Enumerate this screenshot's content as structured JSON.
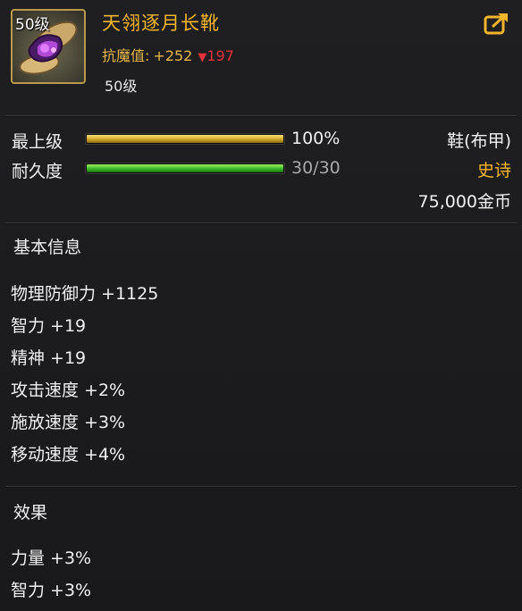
{
  "item": {
    "icon_level": "50级",
    "name": "天翎逐月长靴",
    "resist_label": "抗魔值:",
    "resist_value": "+252",
    "resist_drop_value": "197",
    "level": "50级"
  },
  "bars": {
    "top_level": {
      "label": "最上级",
      "value_text": "100%",
      "fill_fraction": 1.0,
      "color": "#d8ae2e"
    },
    "durability": {
      "label": "耐久度",
      "value_text": "30/30",
      "fill_fraction": 1.0,
      "color": "#3cb82a"
    }
  },
  "info": {
    "type": "鞋(布甲)",
    "rarity": "史诗",
    "rarity_color": "#f2b52b",
    "price": "75,000金币"
  },
  "basic_info": {
    "title": "基本信息",
    "stats": [
      "物理防御力 +1125",
      "智力 +19",
      "精神 +19",
      "攻击速度 +2%",
      "施放速度 +3%",
      "移动速度 +4%"
    ]
  },
  "effects": {
    "title": "效果",
    "stats": [
      "力量 +3%",
      "智力 +3%"
    ]
  },
  "icons": {
    "item_icon": "boots-icon",
    "share": "share-icon",
    "drop_marker": "down-triangle-icon"
  }
}
